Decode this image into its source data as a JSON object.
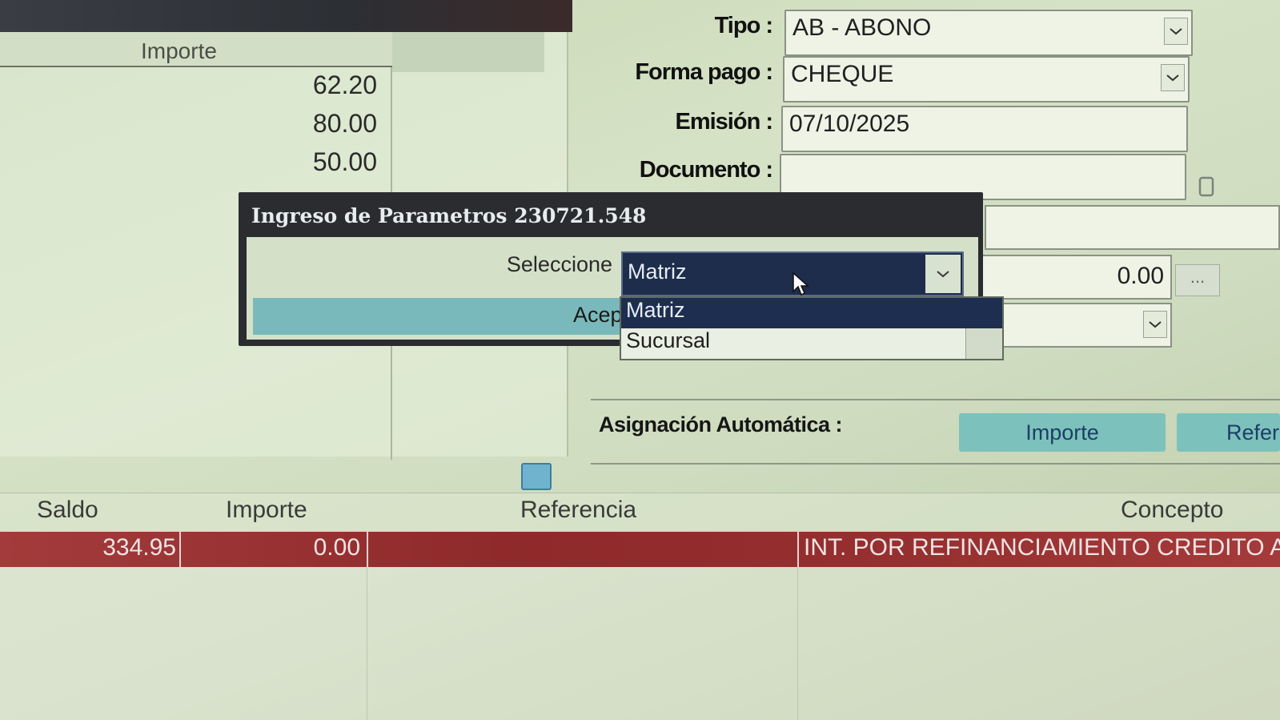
{
  "left_grid": {
    "header": "Importe",
    "amounts": [
      "62.20",
      "80.00",
      "50.00"
    ]
  },
  "form": {
    "tipo_label": "Tipo :",
    "tipo_value": "AB - ABONO",
    "forma_pago_label": "Forma pago :",
    "forma_pago_value": "CHEQUE",
    "emision_label": "Emisión :",
    "emision_value": "07/10/2025",
    "documento_label": "Documento :",
    "documento_value": "",
    "importe_value": "0.00",
    "ellipsis_label": "..."
  },
  "dialog": {
    "title": "Ingreso de Parametros 230721.548",
    "select_label": "Seleccione",
    "selected_value": "Matriz",
    "options": [
      "Matriz",
      "Sucursal"
    ],
    "accept_label": "Acep"
  },
  "asignacion": {
    "label": "Asignación Automática :",
    "importe_button": "Importe",
    "referencia_button": "Refere"
  },
  "table": {
    "headers": [
      "Saldo",
      "Importe",
      "Referencia",
      "Concepto"
    ],
    "rows": [
      {
        "saldo": "334.95",
        "importe": "0.00",
        "referencia": "",
        "concepto": "INT. POR REFINANCIAMIENTO CREDITO A"
      }
    ]
  },
  "colors": {
    "dialog_titlebar": "#2a2c30",
    "selection": "#1e2e50",
    "accent_teal": "#7dc1bd",
    "row_highlight": "#962f2f"
  }
}
